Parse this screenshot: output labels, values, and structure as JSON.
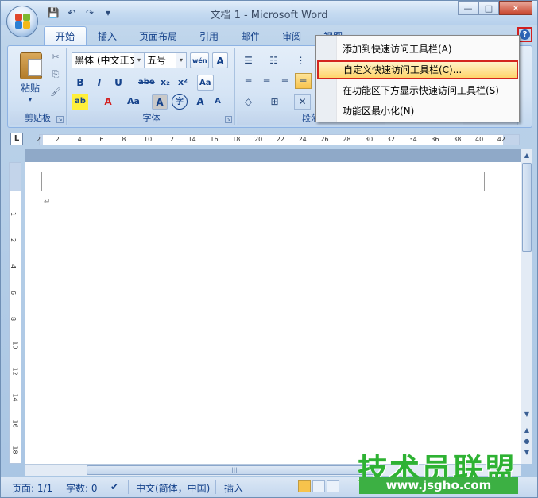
{
  "window": {
    "title": "文档 1 - Microsoft Word",
    "minimize": "—",
    "maximize": "□",
    "close": "✕"
  },
  "qat": {
    "save": "💾",
    "undo": "↶",
    "redo": "↷",
    "customize": "▾"
  },
  "tabs": [
    "开始",
    "插入",
    "页面布局",
    "引用",
    "邮件",
    "审阅",
    "视图"
  ],
  "help_icon": "?",
  "clipboard": {
    "label": "剪贴板",
    "paste": "粘贴",
    "paste_arrow": "▾",
    "cut": "✂",
    "copy": "⎘",
    "format_painter": "🖌"
  },
  "font": {
    "label": "字体",
    "family": "黑体 (中文正文",
    "size": "五号",
    "phonetic": "wén",
    "charborder": "A",
    "bold": "B",
    "italic": "I",
    "underline": "U",
    "strike": "abe",
    "sub": "x₂",
    "sup": "x²",
    "clear": "Aa",
    "highlight": "ab",
    "color": "A",
    "case": "Aa",
    "shade": "A",
    "enclose": "字",
    "grow": "A",
    "shrink": "A"
  },
  "paragraph": {
    "label": "段落",
    "bullets": "☰",
    "numbering": "☷",
    "multilevel": "⋮",
    "align_left": "≡",
    "align_center": "≡",
    "align_right": "≡",
    "justify": "≡",
    "shading": "◇",
    "border": "⊞",
    "sort": "✕"
  },
  "menu": {
    "items": [
      "添加到快速访问工具栏(A)",
      "自定义快速访问工具栏(C)...",
      "在功能区下方显示快速访问工具栏(S)",
      "功能区最小化(N)"
    ],
    "highlighted_index": 1
  },
  "ruler": {
    "tab_selector": "L",
    "h_ticks": [
      "2",
      "2",
      "4",
      "6",
      "8",
      "10",
      "12",
      "14",
      "16",
      "18",
      "20",
      "22",
      "24",
      "26",
      "28",
      "30",
      "32",
      "34",
      "36",
      "38",
      "40",
      "42"
    ],
    "v_ticks": [
      "1",
      "2",
      "4",
      "6",
      "8",
      "10",
      "12",
      "14",
      "16",
      "18"
    ]
  },
  "document": {
    "paragraph_mark": "↵"
  },
  "status": {
    "page": "页面: 1/1",
    "words": "字数: 0",
    "language": "中文(简体，中国)",
    "mode": "插入"
  },
  "watermark": {
    "title": "技术员联盟",
    "url": "www.jsgho.com"
  }
}
